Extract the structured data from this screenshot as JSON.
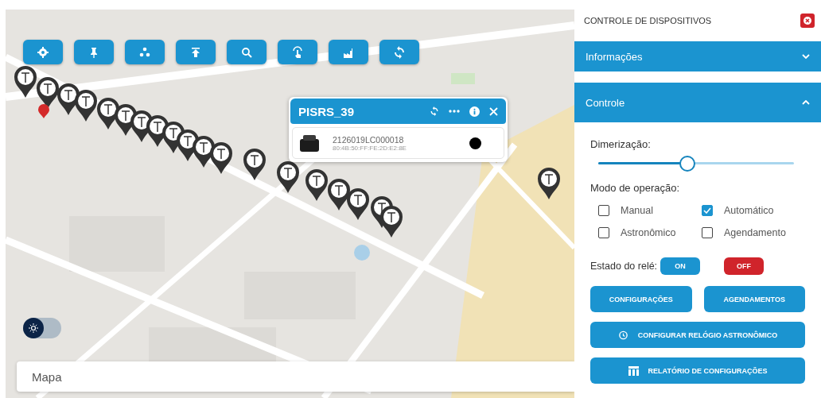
{
  "popup": {
    "title": "PISRS_39",
    "device": {
      "serial": "2126019LC000018",
      "mac": "80:4B:50:FF:FE:2D:E2:8E"
    }
  },
  "theme_toggle": {
    "on": false
  },
  "bottom_bar": {
    "title": "Mapa"
  },
  "panel": {
    "title": "CONTROLE DE DISPOSITIVOS",
    "sections": [
      {
        "title": "Informações",
        "expanded": false
      },
      {
        "title": "Controle",
        "expanded": true
      }
    ],
    "dimming": {
      "label": "Dimerização:",
      "level": 0.45
    },
    "mode": {
      "label": "Modo de operação:",
      "options": [
        {
          "label": "Manual",
          "checked": false
        },
        {
          "label": "Automático",
          "checked": true
        },
        {
          "label": "Astronômico",
          "checked": false
        },
        {
          "label": "Agendamento",
          "checked": false
        }
      ]
    },
    "relay": {
      "label": "Estado do relé:",
      "buttons": [
        {
          "label": "ON",
          "kind": "on"
        },
        {
          "label": "OFF",
          "kind": "off"
        }
      ]
    },
    "actions": [
      {
        "label": "CONFIGURAÇÕES",
        "kind": "plain"
      },
      {
        "label": "AGENDAMENTOS",
        "kind": "plain"
      },
      {
        "label": "CONFIGURAR RELÓGIO ASTRONÔMICO",
        "kind": "clock"
      },
      {
        "label": "RELATÓRIO DE CONFIGURAÇÕES",
        "kind": "table"
      }
    ]
  }
}
